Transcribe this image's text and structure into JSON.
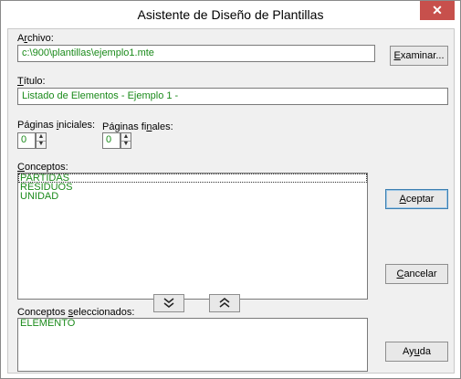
{
  "window": {
    "title": "Asistente de Diseño de Plantillas",
    "close_glyph": "✕"
  },
  "archivo": {
    "label_pre": "A",
    "label_key": "r",
    "label_post": "chivo:",
    "value": "c:\\900\\plantillas\\ejemplo1.mte"
  },
  "examinar_button": {
    "pre": "",
    "key": "E",
    "post": "xaminar..."
  },
  "titulo": {
    "label_key": "T",
    "label_post": "ítulo:",
    "value": "Listado de Elementos - Ejemplo 1 -"
  },
  "paginas_iniciales": {
    "label_pre": "Páginas ",
    "label_key": "i",
    "label_post": "niciales:",
    "value": "0"
  },
  "paginas_finales": {
    "label_pre": "Páginas fi",
    "label_key": "n",
    "label_post": "ales:",
    "value": "0"
  },
  "conceptos": {
    "label_key": "C",
    "label_post": "onceptos:",
    "items": [
      "PARTIDAS",
      "RESIDUOS",
      "UNIDAD"
    ]
  },
  "aceptar_button": {
    "key": "A",
    "post": "ceptar"
  },
  "cancelar_button": {
    "key": "C",
    "post": "ancelar"
  },
  "conceptos_seleccionados": {
    "label_pre": "Conceptos ",
    "label_key": "s",
    "label_post": "eleccionados:",
    "items": [
      "ELEMENTO"
    ]
  },
  "ayuda_button": {
    "pre": "Ay",
    "key": "u",
    "post": "da"
  },
  "icons": {
    "move_down": "double-chevron-down-icon",
    "move_up": "double-chevron-up-icon",
    "spin_up": "▲",
    "spin_down": "▼"
  }
}
